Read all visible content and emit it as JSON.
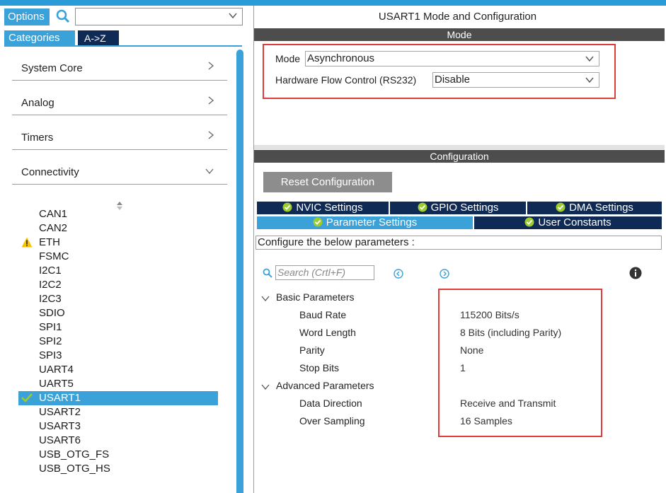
{
  "left": {
    "options_label": "Options",
    "search_value": "",
    "tabs": {
      "categories": "Categories",
      "az": "A->Z"
    },
    "categories": [
      {
        "label": "System Core"
      },
      {
        "label": "Analog"
      },
      {
        "label": "Timers"
      },
      {
        "label": "Connectivity"
      }
    ],
    "peripherals": [
      "CAN1",
      "CAN2",
      "ETH",
      "FSMC",
      "I2C1",
      "I2C2",
      "I2C3",
      "SDIO",
      "SPI1",
      "SPI2",
      "SPI3",
      "UART4",
      "UART5",
      "USART1",
      "USART2",
      "USART3",
      "USART6",
      "USB_OTG_FS",
      "USB_OTG_HS"
    ],
    "selected_peripheral": "USART1",
    "warning_peripheral": "ETH"
  },
  "right": {
    "title": "USART1 Mode and Configuration",
    "mode_section": "Mode",
    "mode_label": "Mode",
    "mode_value": "Asynchronous",
    "flow_label": "Hardware Flow Control (RS232)",
    "flow_value": "Disable",
    "config_section": "Configuration",
    "reset_label": "Reset Configuration",
    "tabs": {
      "nvic": "NVIC Settings",
      "gpio": "GPIO Settings",
      "dma": "DMA Settings",
      "params": "Parameter Settings",
      "user": "User Constants"
    },
    "instruction": "Configure the below parameters :",
    "search_placeholder": "Search (Crtl+F)",
    "groups": {
      "basic": "Basic Parameters",
      "advanced": "Advanced Parameters"
    },
    "params": {
      "baud": {
        "name": "Baud Rate",
        "value": "115200 Bits/s"
      },
      "word": {
        "name": "Word Length",
        "value": "8 Bits (including Parity)"
      },
      "parity": {
        "name": "Parity",
        "value": "None"
      },
      "stop": {
        "name": "Stop Bits",
        "value": "1"
      },
      "direction": {
        "name": "Data Direction",
        "value": "Receive and Transmit"
      },
      "oversampling": {
        "name": "Over Sampling",
        "value": "16 Samples"
      }
    }
  },
  "colors": {
    "accent": "#3ba2d9",
    "navy": "#0f2a55",
    "highlight": "#e23b3b",
    "check_green": "#9ccc2e",
    "warning": "#f5c400"
  }
}
